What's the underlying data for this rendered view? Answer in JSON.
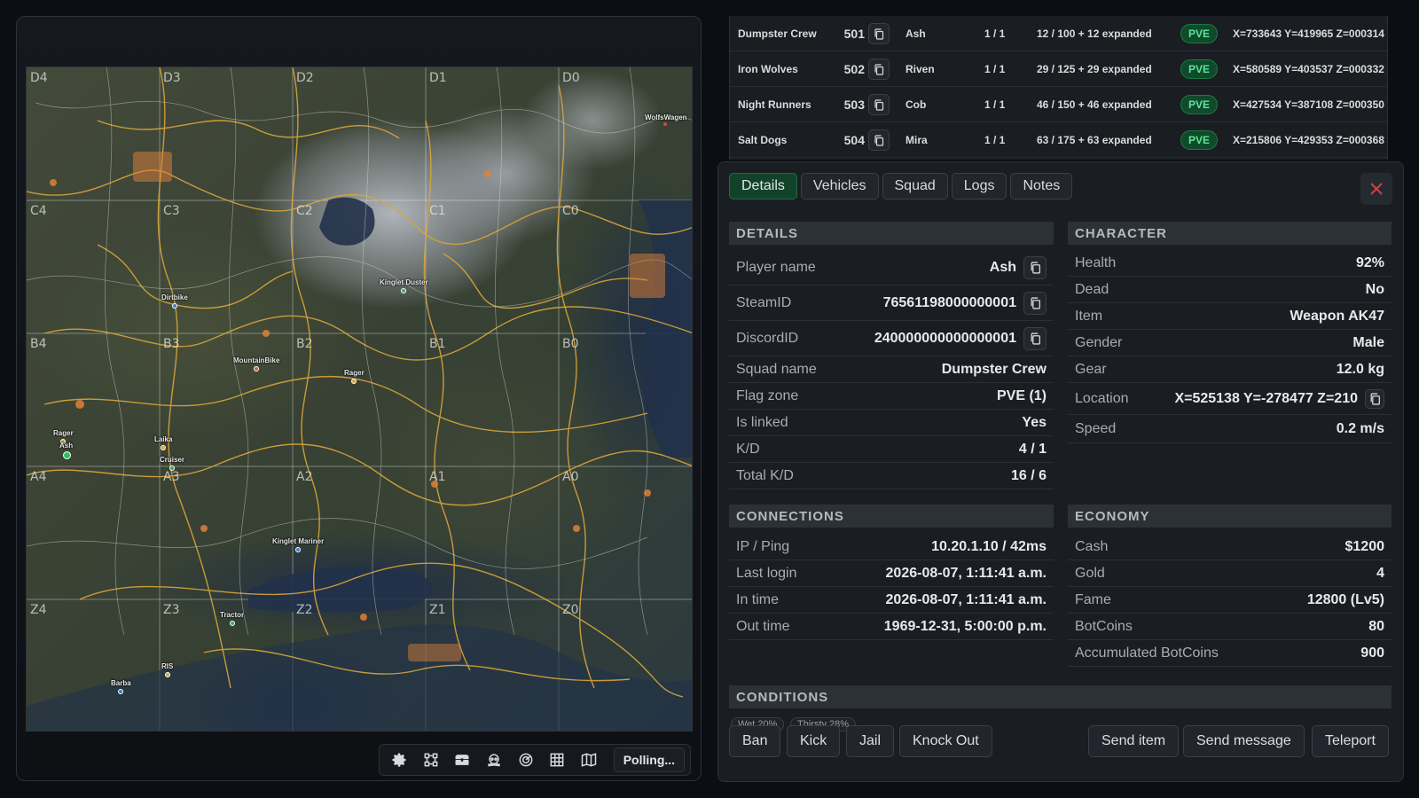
{
  "map": {
    "grid_labels": [
      "D4",
      "D3",
      "D2",
      "D1",
      "D0",
      "C4",
      "C3",
      "C2",
      "C1",
      "C0",
      "B4",
      "B3",
      "B2",
      "B1",
      "B0",
      "A4",
      "A3",
      "A2",
      "A1",
      "A0",
      "Z4",
      "Z3",
      "Z2",
      "Z1",
      "Z0"
    ],
    "pois": [
      "WolfsWagen",
      "Kinglet Duster",
      "Dirtbike",
      "MountainBike",
      "Rager",
      "Rager",
      "Ash",
      "Laika",
      "Cruiser",
      "Kinglet Mariner",
      "Tractor",
      "RIS",
      "Barba"
    ],
    "toolbar": {
      "icons": [
        "gear-icon",
        "squad-icon",
        "chest-icon",
        "skull-icon",
        "radar-icon",
        "grid-icon",
        "map-icon"
      ],
      "polling_label": "Polling..."
    }
  },
  "squads": [
    {
      "squad": "Dumpster Crew",
      "id": "501",
      "name": "Ash",
      "count": "1 / 1",
      "capacity": "12 / 100 + 12 expanded",
      "flag": "PVE",
      "position": "X=733643 Y=419965 Z=000314"
    },
    {
      "squad": "Iron Wolves",
      "id": "502",
      "name": "Riven",
      "count": "1 / 1",
      "capacity": "29 / 125 + 29 expanded",
      "flag": "PVE",
      "position": "X=580589 Y=403537 Z=000332"
    },
    {
      "squad": "Night Runners",
      "id": "503",
      "name": "Cob",
      "count": "1 / 1",
      "capacity": "46 / 150 + 46 expanded",
      "flag": "PVE",
      "position": "X=427534 Y=387108 Z=000350"
    },
    {
      "squad": "Salt Dogs",
      "id": "504",
      "name": "Mira",
      "count": "1 / 1",
      "capacity": "63 / 175 + 63 expanded",
      "flag": "PVE",
      "position": "X=215806 Y=429353 Z=000368"
    }
  ],
  "tabs": [
    "Details",
    "Vehicles",
    "Squad",
    "Logs",
    "Notes"
  ],
  "sections": {
    "details": "DETAILS",
    "character": "CHARACTER",
    "connections": "CONNECTIONS",
    "economy": "ECONOMY",
    "conditions": "CONDITIONS"
  },
  "details": [
    {
      "k": "Player name",
      "v": "Ash"
    },
    {
      "k": "SteamID",
      "v": "76561198000000001"
    },
    {
      "k": "DiscordID",
      "v": "240000000000000001"
    },
    {
      "k": "Squad name",
      "v": "Dumpster Crew"
    },
    {
      "k": "Flag zone",
      "v": "PVE (1)"
    },
    {
      "k": "Is linked",
      "v": "Yes"
    },
    {
      "k": "K/D",
      "v": "4 / 1"
    },
    {
      "k": "Total K/D",
      "v": "16 / 6"
    }
  ],
  "character": [
    {
      "k": "Health",
      "v": "92%"
    },
    {
      "k": "Dead",
      "v": "No"
    },
    {
      "k": "Item",
      "v": "Weapon AK47"
    },
    {
      "k": "Gender",
      "v": "Male"
    },
    {
      "k": "Gear",
      "v": "12.0 kg"
    },
    {
      "k": "Location",
      "v": "X=525138 Y=-278477 Z=210"
    },
    {
      "k": "Speed",
      "v": "0.2 m/s"
    }
  ],
  "connections": [
    {
      "k": "IP / Ping",
      "v": "10.20.1.10 / 42ms"
    },
    {
      "k": "Last login",
      "v": "2026-08-07, 1:11:41 a.m."
    },
    {
      "k": "In time",
      "v": "2026-08-07, 1:11:41 a.m."
    },
    {
      "k": "Out time",
      "v": "1969-12-31, 5:00:00 p.m."
    }
  ],
  "economy": [
    {
      "k": "Cash",
      "v": "$1200"
    },
    {
      "k": "Gold",
      "v": "4"
    },
    {
      "k": "Fame",
      "v": "12800 (Lv5)"
    },
    {
      "k": "BotCoins",
      "v": "80"
    },
    {
      "k": "Accumulated BotCoins",
      "v": "900"
    }
  ],
  "conditions": [
    "Wet 20%",
    "Thirsty 28%"
  ],
  "actions_left": [
    "Ban",
    "Kick",
    "Jail",
    "Knock Out"
  ],
  "actions_right": [
    "Send item",
    "Send message",
    "Teleport"
  ],
  "colors": {
    "accent": "#12432a",
    "pve": "#5ee59a",
    "close": "#e03a3a",
    "road": "#d9a63a"
  }
}
